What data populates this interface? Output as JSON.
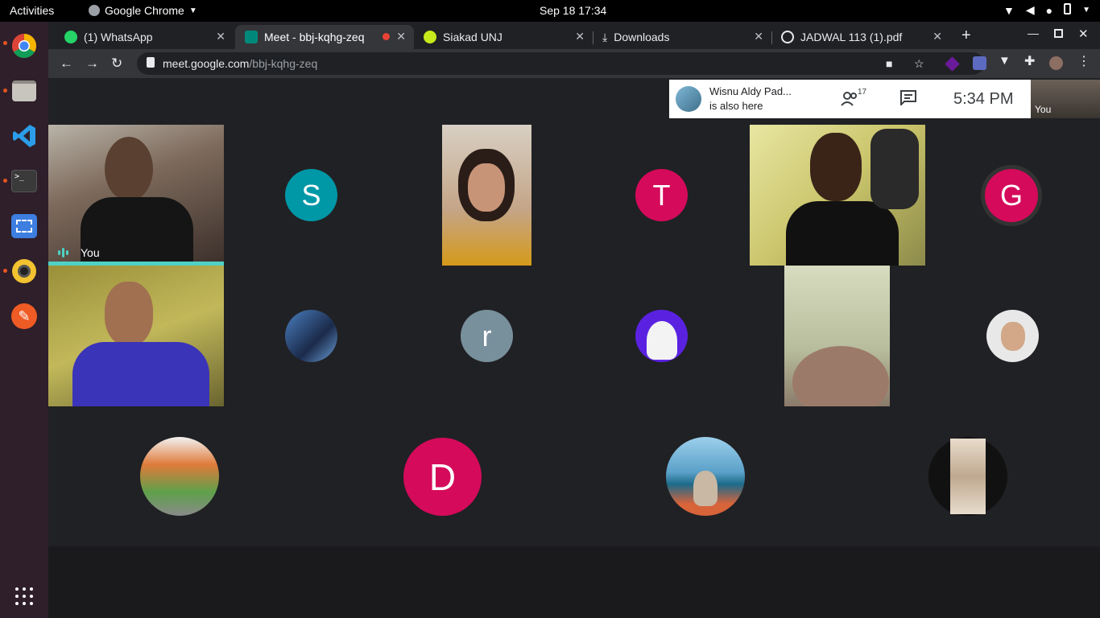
{
  "system": {
    "activities": "Activities",
    "app_name": "Google Chrome",
    "clock": "Sep 18  17:34"
  },
  "tabs": [
    {
      "label": "(1) WhatsApp",
      "icon": "whatsapp-icon",
      "color": "#25d366"
    },
    {
      "label": "Meet - bbj-kqhg-zeq",
      "icon": "meet-icon",
      "color": "#00897b",
      "active": true
    },
    {
      "label": "Siakad UNJ",
      "icon": "siakad-icon",
      "color": "#c6ea1b"
    },
    {
      "label": "Downloads",
      "icon": "download-icon",
      "color": "#e8eaed"
    },
    {
      "label": "JADWAL 113 (1).pdf",
      "icon": "globe-icon",
      "color": "#e8eaed"
    }
  ],
  "omnibox": {
    "host": "meet.google.com",
    "path": "/bbj-kqhg-zeq"
  },
  "meet": {
    "notice_name": "Wisnu Aldy Pad...",
    "notice_text": "is also here",
    "participant_count": "17",
    "time": "5:34  PM",
    "self_label": "You"
  },
  "participants": [
    {
      "label": "You"
    },
    {
      "initial": "S",
      "color": "#0097a7"
    },
    {
      "initial": "T",
      "color": "#d50a5b"
    },
    {
      "initial": "G",
      "color": "#d50a5b"
    },
    {
      "initial": "r",
      "color": "#78909c"
    },
    {
      "initial": "D",
      "color": "#d50a5b"
    }
  ]
}
